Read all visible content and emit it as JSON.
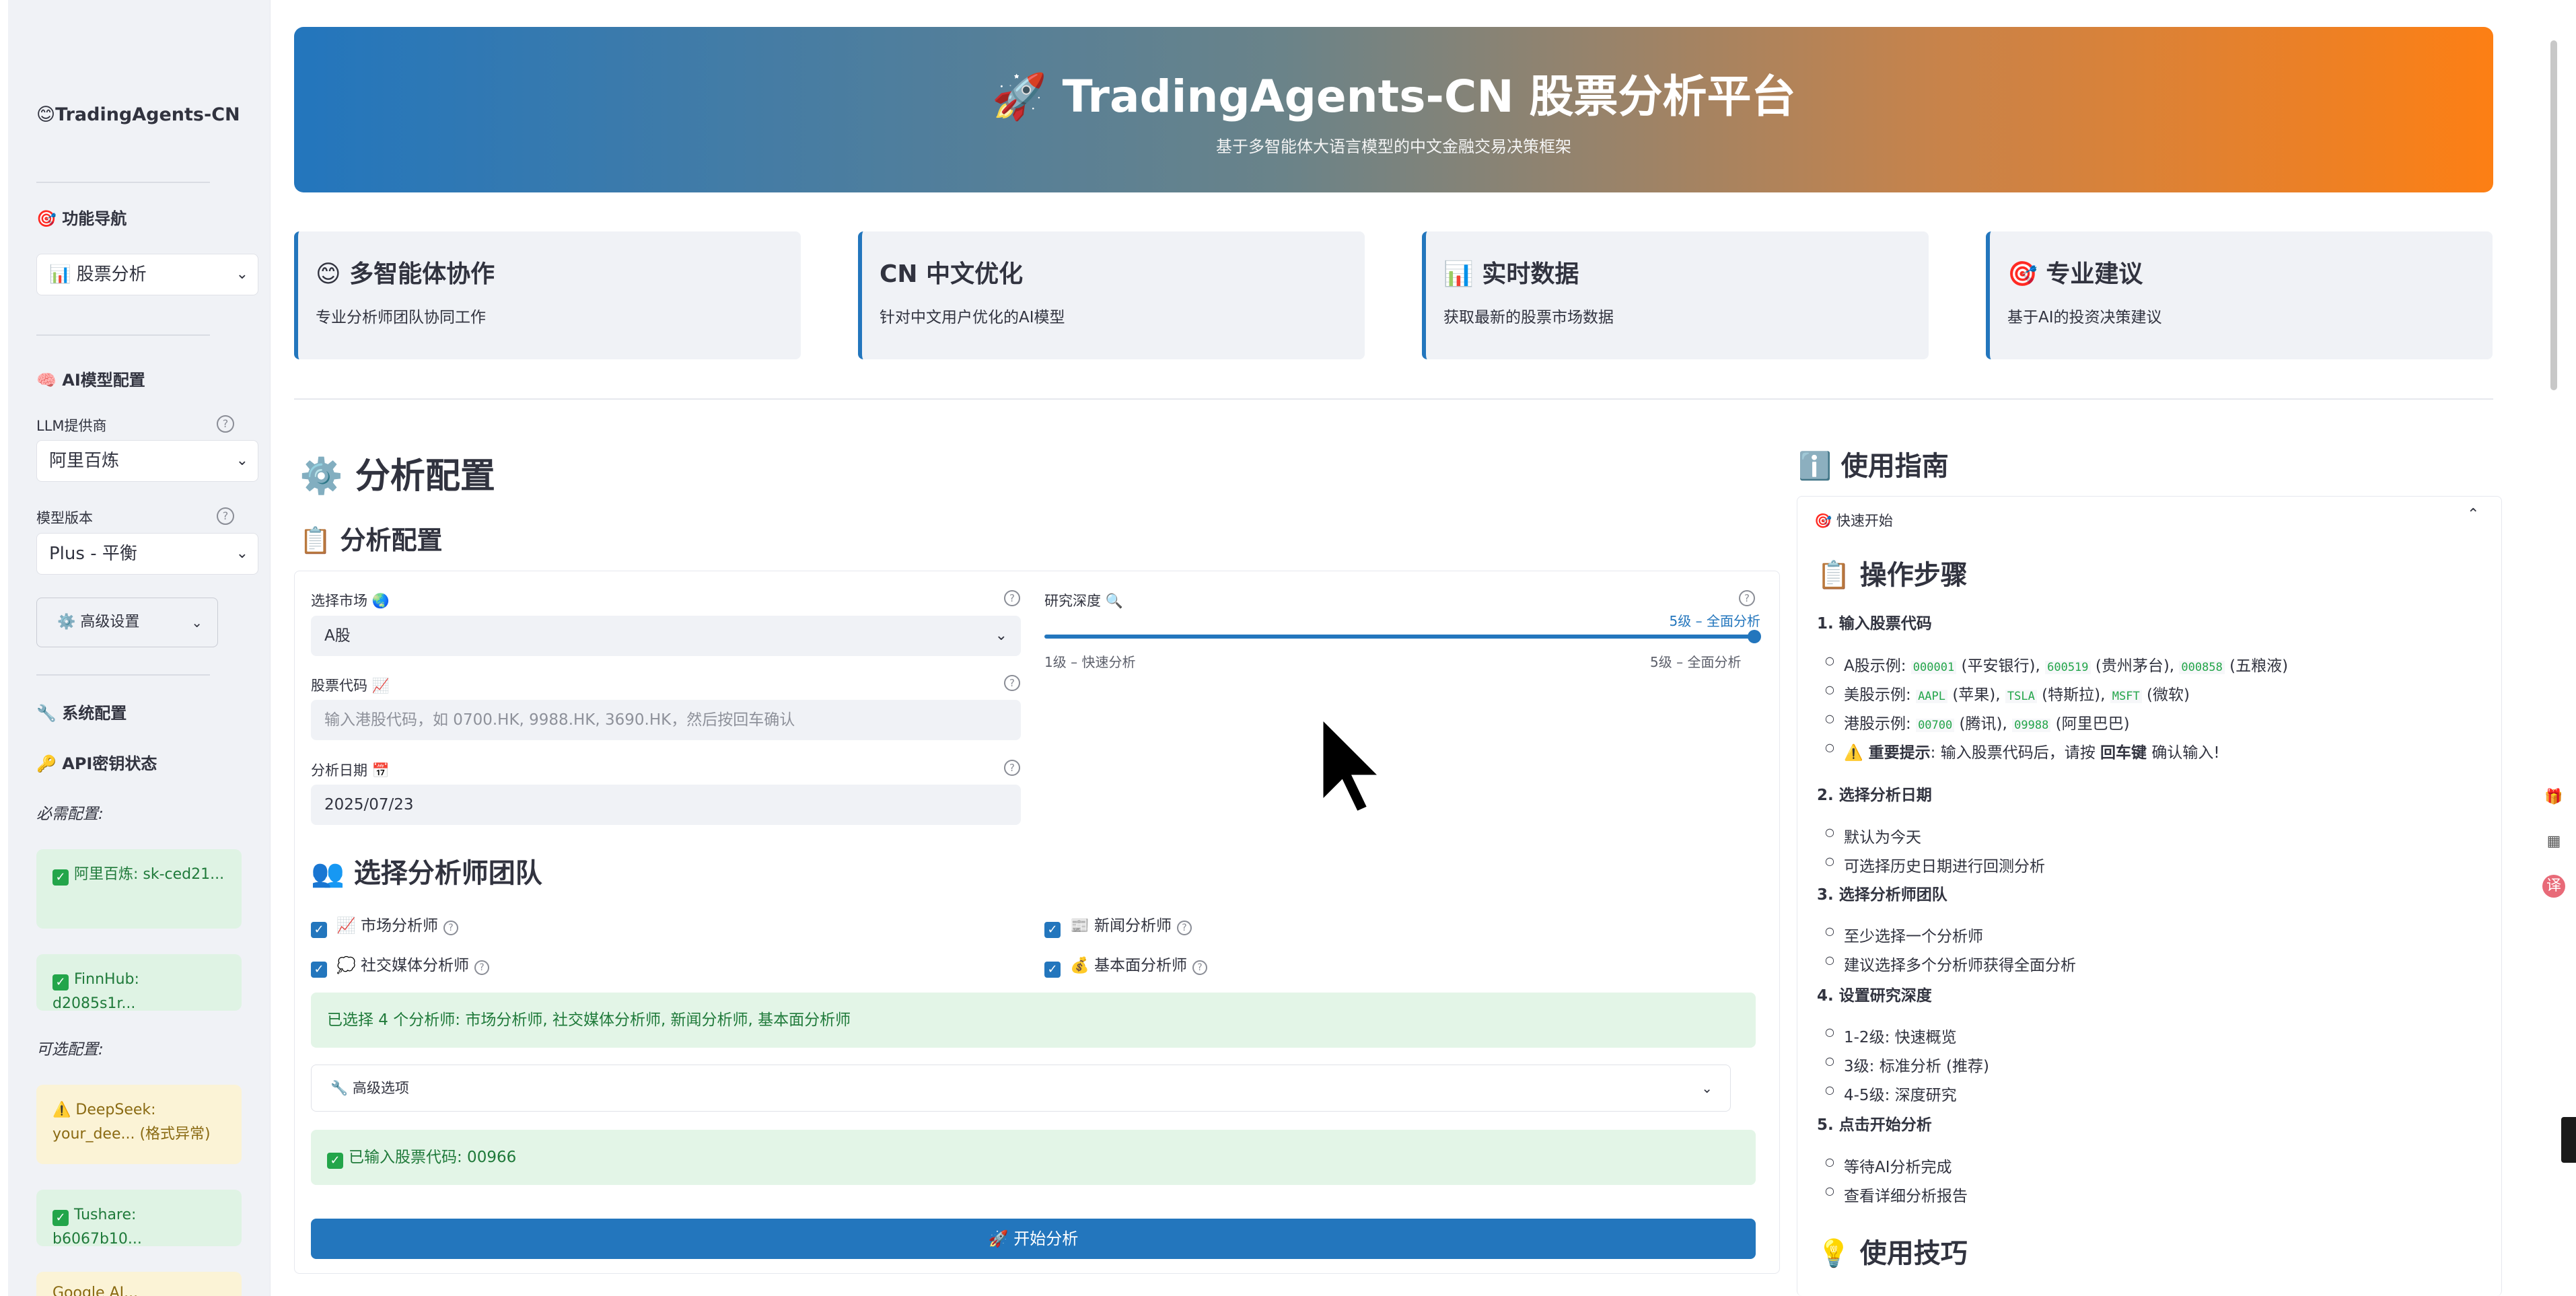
{
  "sidebar": {
    "app_title": "😊TradingAgents-CN",
    "nav_heading": "🎯 功能导航",
    "nav_select": "📊 股票分析",
    "ai_heading": "🧠 AI模型配置",
    "llm_label": "LLM提供商",
    "llm_value": "阿里百炼",
    "model_label": "模型版本",
    "model_value": "Plus - 平衡",
    "advanced_button": "⚙️ 高级设置",
    "system_heading": "🔧 系统配置",
    "api_heading": "🔑 API密钥状态",
    "required_label": "必需配置:",
    "required": [
      "阿里百炼: sk-ced21...",
      "FinnHub: d2085s1r..."
    ],
    "optional_label": "可选配置:",
    "optional_warn": "DeepSeek: your_dee... (格式异常)",
    "optional_ok": "Tushare: b6067b10...",
    "optional_partial": "Google AI..."
  },
  "banner": {
    "title": "🚀 TradingAgents-CN 股票分析平台",
    "subtitle": "基于多智能体大语言模型的中文金融交易决策框架"
  },
  "features": [
    {
      "title": "😊 多智能体协作",
      "desc": "专业分析师团队协同工作"
    },
    {
      "title": "CN 中文优化",
      "desc": "针对中文用户优化的AI模型"
    },
    {
      "title": "📊 实时数据",
      "desc": "获取最新的股票市场数据"
    },
    {
      "title": "🎯 专业建议",
      "desc": "基于AI的投资决策建议"
    }
  ],
  "config": {
    "page_heading": "⚙️ 分析配置",
    "form_heading": "📋 分析配置",
    "market_label": "选择市场 🌏",
    "market_value": "A股",
    "code_label": "股票代码 📈",
    "code_placeholder": "输入港股代码，如 0700.HK, 9988.HK, 3690.HK，然后按回车确认",
    "date_label": "分析日期 📅",
    "date_value": "2025/07/23",
    "depth_label": "研究深度 🔍",
    "depth_value": "5级 – 全面分析",
    "depth_min": "1级 – 快速分析",
    "depth_max": "5级 – 全面分析",
    "depth_level": 5,
    "team_heading": "👥 选择分析师团队",
    "analysts": [
      "📈 市场分析师",
      "📰 新闻分析师",
      "💭 社交媒体分析师",
      "💰 基本面分析师"
    ],
    "selected_msg": "已选择 4 个分析师: 市场分析师, 社交媒体分析师, 新闻分析师, 基本面分析师",
    "advanced_options": "🔧 高级选项",
    "entered_code": "已输入股票代码: 00966",
    "start_button": "🚀 开始分析"
  },
  "guide": {
    "heading": "ℹ️ 使用指南",
    "quick_start": "🎯 快速开始",
    "steps_heading": "📋 操作步骤",
    "s1": "1. 输入股票代码",
    "s1a_pre": "A股示例: ",
    "s1a_c1": "000001",
    "s1a_t1": " (平安银行), ",
    "s1a_c2": "600519",
    "s1a_t2": " (贵州茅台), ",
    "s1a_c3": "000858",
    "s1a_t3": " (五粮液)",
    "s1b_pre": "美股示例: ",
    "s1b_c1": "AAPL",
    "s1b_t1": " (苹果), ",
    "s1b_c2": "TSLA",
    "s1b_t2": " (特斯拉), ",
    "s1b_c3": "MSFT",
    "s1b_t3": " (微软)",
    "s1c_pre": "港股示例: ",
    "s1c_c1": "00700",
    "s1c_t1": " (腾讯), ",
    "s1c_c2": "09988",
    "s1c_t2": " (阿里巴巴)",
    "s1d_bold": "⚠️ 重要提示",
    "s1d_t1": ": 输入股票代码后，请按 ",
    "s1d_key": "回车键",
    "s1d_t2": " 确认输入!",
    "s2": "2. 选择分析日期",
    "s2a": "默认为今天",
    "s2b": "可选择历史日期进行回测分析",
    "s3": "3. 选择分析师团队",
    "s3a": "至少选择一个分析师",
    "s3b": "建议选择多个分析师获得全面分析",
    "s4": "4. 设置研究深度",
    "s4a": "1-2级: 快速概览",
    "s4b": "3级: 标准分析 (推荐)",
    "s4c": "4-5级: 深度研究",
    "s5": "5. 点击开始分析",
    "s5a": "等待AI分析完成",
    "s5b": "查看详细分析报告",
    "tips_heading": "💡 使用技巧"
  }
}
